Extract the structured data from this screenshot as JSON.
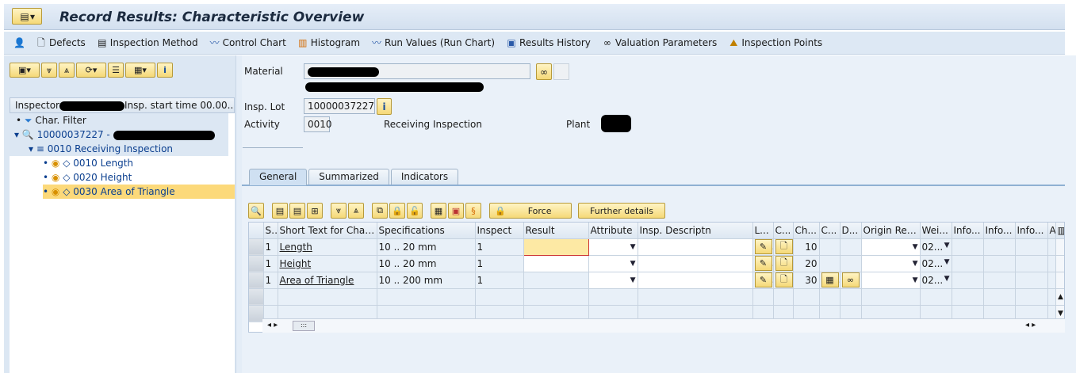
{
  "window": {
    "title": "Record Results: Characteristic Overview"
  },
  "toolbar": [
    {
      "label": "Defects",
      "icon": "document-icon"
    },
    {
      "label": "Inspection Method",
      "icon": "inspection-method-icon"
    },
    {
      "label": "Control Chart",
      "icon": "control-chart-icon"
    },
    {
      "label": "Histogram",
      "icon": "histogram-icon"
    },
    {
      "label": "Run Values (Run Chart)",
      "icon": "run-chart-icon"
    },
    {
      "label": "Results History",
      "icon": "results-history-icon"
    },
    {
      "label": "Valuation Parameters",
      "icon": "glasses-icon"
    },
    {
      "label": "Inspection Points",
      "icon": "inspection-points-icon"
    }
  ],
  "left": {
    "header_inspector": "Inspector",
    "header_start": "Insp. start time 00.00...",
    "tree": {
      "filter": "Char. Filter",
      "lot": "10000037227 -",
      "op": "0010 Receiving Inspection",
      "chars": [
        "0010 Length",
        "0020 Height",
        "0030 Area of Triangle"
      ]
    }
  },
  "header": {
    "material_label": "Material",
    "insp_lot_label": "Insp. Lot",
    "insp_lot": "10000037227",
    "activity_label": "Activity",
    "activity": "0010",
    "activity_text": "Receiving Inspection",
    "plant_label": "Plant"
  },
  "tabs": [
    "General",
    "Summarized",
    "Indicators"
  ],
  "buttons": {
    "force": "Force",
    "further": "Further details"
  },
  "grid": {
    "columns": [
      "S..",
      "Short Text for Char...",
      "Specifications",
      "Inspect",
      "Result",
      "Attribute",
      "Insp. Descriptn",
      "L...",
      "C...",
      "Ch...",
      "C...",
      "D...",
      "Origin Res...",
      "Wei...",
      "Info...",
      "Info...",
      "Info...",
      "A"
    ],
    "rows": [
      {
        "s": "1",
        "text": "Length",
        "spec": "10 .. 20 mm",
        "inspect": "1",
        "result": "",
        "ch": "10",
        "wei": "02..."
      },
      {
        "s": "1",
        "text": "Height",
        "spec": "10 .. 20 mm",
        "inspect": "1",
        "result": "",
        "ch": "20",
        "wei": "02..."
      },
      {
        "s": "1",
        "text": "Area of Triangle",
        "spec": "10 .. 200 mm",
        "inspect": "1",
        "result": "",
        "ch": "30",
        "wei": "02..."
      }
    ]
  }
}
